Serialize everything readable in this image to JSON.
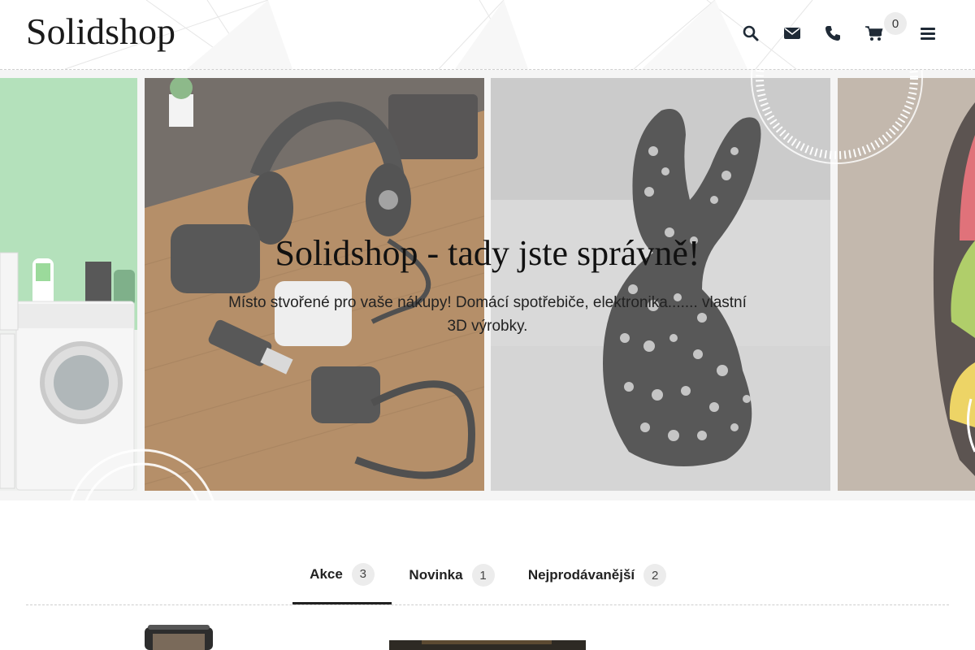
{
  "site": {
    "logo": "Solidshop"
  },
  "header": {
    "icons": [
      "search-icon",
      "envelope-icon",
      "phone-icon",
      "cart-icon",
      "menu-icon"
    ],
    "cart_count": "0"
  },
  "hero": {
    "title": "Solidshop - tady jste správně!",
    "subtitle": "Místo stvořené pro vaše nákupy! Domácí spotřebiče, elektronika....... vlastní 3D výrobky.",
    "slides": [
      "home-appliances-slide",
      "electronics-slide",
      "3d-printed-bunny-slide",
      "3d-printed-figure-slide"
    ]
  },
  "tabs": [
    {
      "label": "Akce",
      "count": "3",
      "active": true
    },
    {
      "label": "Novinka",
      "count": "1",
      "active": false
    },
    {
      "label": "Nejprodávanější",
      "count": "2",
      "active": false
    }
  ],
  "colors": {
    "accent": "#222222",
    "badge_bg": "#ececec",
    "slide_green": "#9fd9a8"
  }
}
